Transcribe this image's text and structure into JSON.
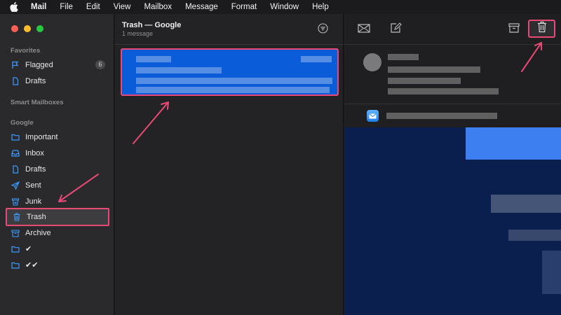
{
  "menubar": {
    "items": [
      "Mail",
      "File",
      "Edit",
      "View",
      "Mailbox",
      "Message",
      "Format",
      "Window",
      "Help"
    ]
  },
  "sidebar": {
    "favorites_label": "Favorites",
    "smart_label": "Smart Mailboxes",
    "google_label": "Google",
    "flagged": {
      "label": "Flagged",
      "badge": "6",
      "icon": "flag-icon"
    },
    "fav_drafts": {
      "label": "Drafts",
      "icon": "document-icon"
    },
    "important": {
      "label": "Important",
      "icon": "folder-icon"
    },
    "inbox": {
      "label": "Inbox",
      "icon": "inbox-tray-icon"
    },
    "drafts": {
      "label": "Drafts",
      "icon": "document-icon"
    },
    "sent": {
      "label": "Sent",
      "icon": "paper-plane-icon"
    },
    "junk": {
      "label": "Junk",
      "icon": "junk-bin-icon"
    },
    "trash": {
      "label": "Trash",
      "icon": "trash-icon"
    },
    "archive": {
      "label": "Archive",
      "icon": "archive-box-icon"
    },
    "folder1": {
      "label": "✔",
      "icon": "folder-icon"
    },
    "folder2": {
      "label": "✔✔",
      "icon": "folder-icon"
    }
  },
  "message_list": {
    "title": "Trash — Google",
    "subtitle": "1 message"
  },
  "colors": {
    "accent": "#0a5cd8",
    "highlight_annotation": "#e84a75",
    "icon_blue": "#3b9bff"
  }
}
